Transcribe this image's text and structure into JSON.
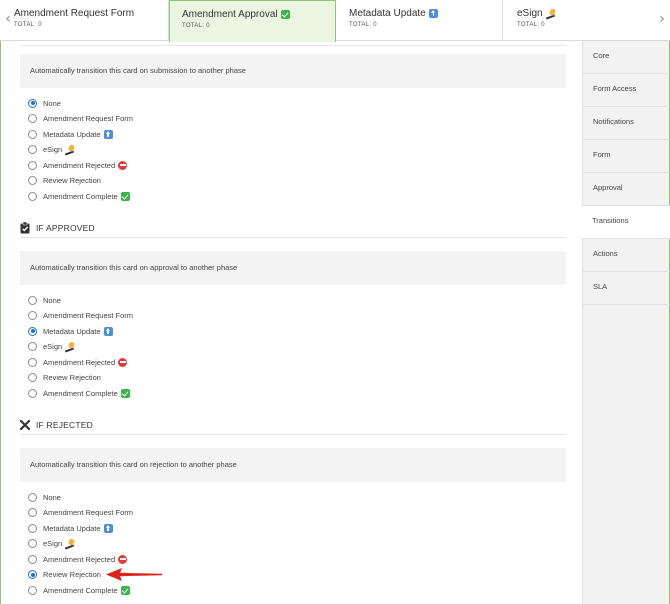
{
  "phases": [
    {
      "name": "Amendment Request Form",
      "total": "TOTAL: 0",
      "emoji": ""
    },
    {
      "name": "Amendment Approval",
      "total": "TOTAL: 0",
      "emoji": "check"
    },
    {
      "name": "Metadata Update",
      "total": "TOTAL: 0",
      "emoji": "up"
    },
    {
      "name": "eSign",
      "total": "TOTAL: 0",
      "emoji": "hand"
    }
  ],
  "sidebar": {
    "items": [
      "Core",
      "Form Access",
      "Notifications",
      "Form",
      "Approval",
      "Transitions",
      "Actions",
      "SLA"
    ],
    "active": "Transitions"
  },
  "sections": {
    "submission": {
      "description": "Automatically transition this card on submission to another phase",
      "selected": "None"
    },
    "approved": {
      "title": "IF APPROVED",
      "description": "Automatically transition this card on approval to another phase",
      "selected": "Metadata Update"
    },
    "rejected": {
      "title": "IF REJECTED",
      "description": "Automatically transition this card on rejection to another phase",
      "selected": "Review Rejection"
    }
  },
  "options": [
    {
      "label": "None",
      "emoji": ""
    },
    {
      "label": "Amendment Request Form",
      "emoji": ""
    },
    {
      "label": "Metadata Update",
      "emoji": "up"
    },
    {
      "label": "eSign",
      "emoji": "hand"
    },
    {
      "label": "Amendment Rejected",
      "emoji": "stop"
    },
    {
      "label": "Review Rejection",
      "emoji": ""
    },
    {
      "label": "Amendment Complete",
      "emoji": "check"
    }
  ],
  "colors": {
    "accent_green": "#8dc572",
    "active_tab_bg": "#eaf6e2",
    "radio_blue": "#1f6fd1",
    "annotation_red": "#e0201a"
  },
  "icons": {
    "prev": "chevron-left-icon",
    "next": "chevron-right-icon",
    "approved": "clipboard-check-icon",
    "rejected": "x-icon"
  }
}
